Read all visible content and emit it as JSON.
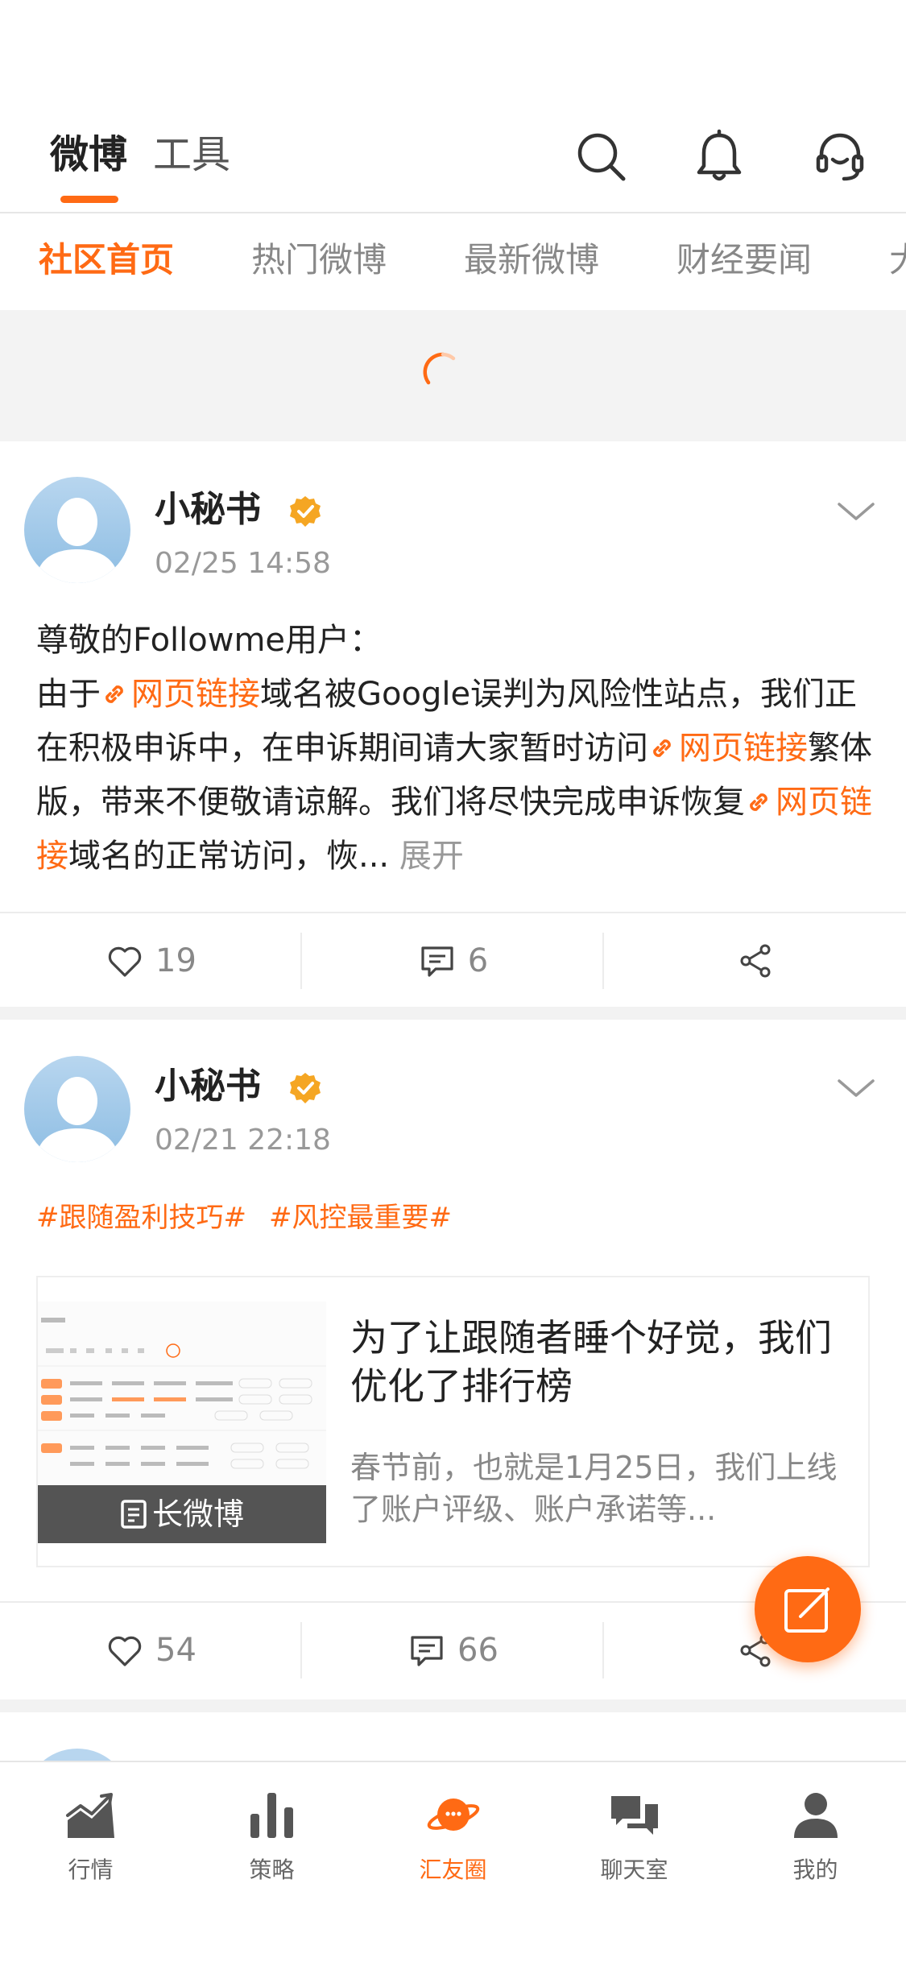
{
  "header": {
    "tabs": [
      {
        "label": "微博",
        "active": true
      },
      {
        "label": "工具",
        "active": false
      }
    ],
    "icons": [
      "search-icon",
      "bell-icon",
      "headset-icon"
    ]
  },
  "subtabs": [
    {
      "label": "社区首页",
      "active": true
    },
    {
      "label": "热门微博",
      "active": false
    },
    {
      "label": "最新微博",
      "active": false
    },
    {
      "label": "财经要闻",
      "active": false
    },
    {
      "label": "大",
      "active": false
    }
  ],
  "posts": [
    {
      "username": "小秘书",
      "time": "02/25 14:58",
      "body": {
        "line1": "尊敬的Followme用户：",
        "p1": "由于",
        "link1": "网页链接",
        "p2": "域名被Google误判为风险性站点，我们正在积极申诉中，在申诉期间请大家暂时访问",
        "link2": "网页链接",
        "p3": "繁体版，带来不便敬请谅解。我们将尽快完成申诉恢复",
        "link3": "网页链接",
        "p4": "域名的正常访问，恢...",
        "more": "展开"
      },
      "likes": "19",
      "comments": "6"
    },
    {
      "username": "小秘书",
      "time": "02/21 22:18",
      "hashtags": [
        "#跟随盈利技巧#",
        "#风控最重要#"
      ],
      "card": {
        "badge": "长微博",
        "title": "为了让跟随者睡个好觉，我们优化了排行榜",
        "desc": "春节前，也就是1月25日，我们上线了账户评级、账户承诺等..."
      },
      "likes": "54",
      "comments": "66"
    }
  ],
  "tabbar": [
    {
      "label": "行情",
      "icon": "market-chart-icon",
      "active": false
    },
    {
      "label": "策略",
      "icon": "bar-chart-icon",
      "active": false
    },
    {
      "label": "汇友圈",
      "icon": "planet-icon",
      "active": true
    },
    {
      "label": "聊天室",
      "icon": "chat-icon",
      "active": false
    },
    {
      "label": "我的",
      "icon": "user-icon",
      "active": false
    }
  ],
  "colors": {
    "accent": "#ff6a14",
    "text": "#222222",
    "muted": "#999999",
    "separator": "#f2f2f2"
  }
}
